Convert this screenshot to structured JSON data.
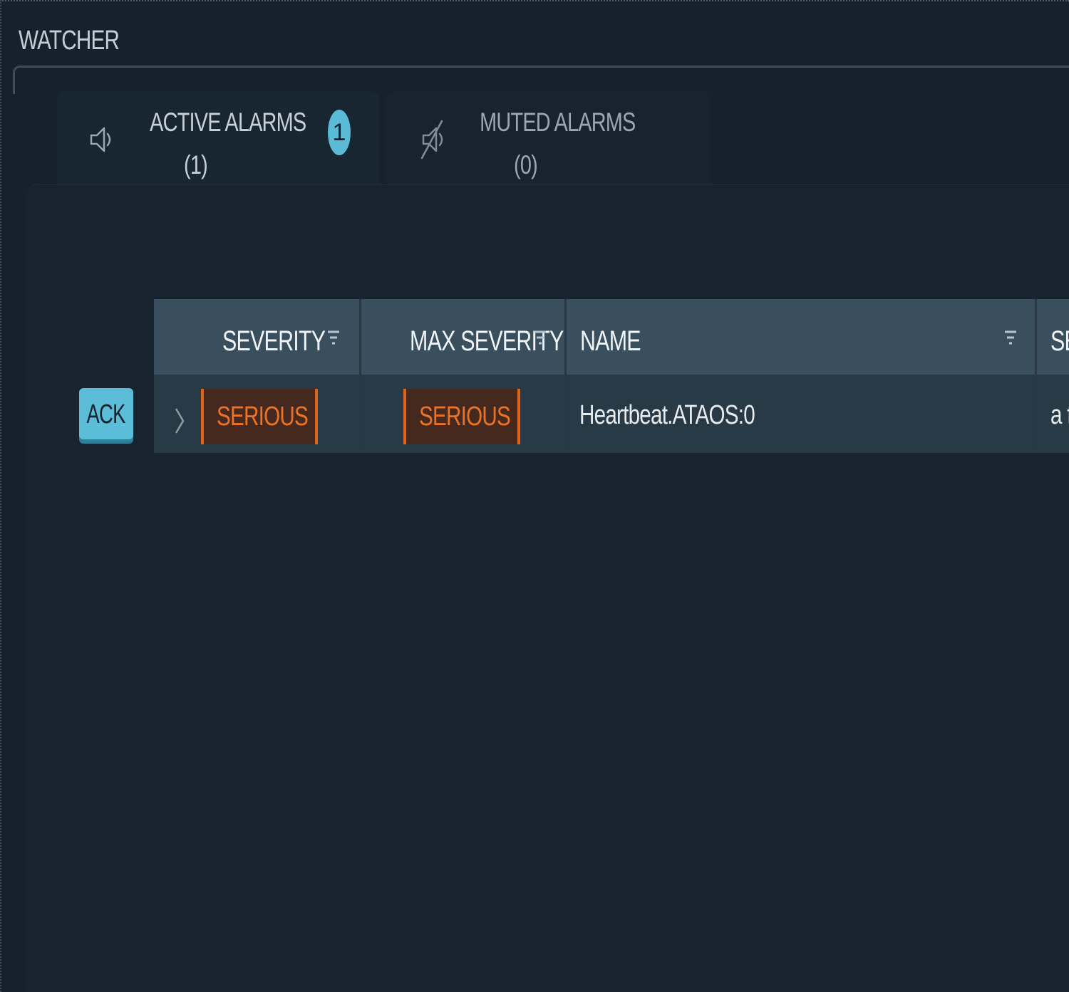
{
  "app": {
    "title": "WATCHER"
  },
  "tabs": [
    {
      "label": "ACTIVE ALARMS",
      "count_text": "(1)",
      "badge": "1",
      "icon": "speaker-icon",
      "active": true
    },
    {
      "label": "MUTED ALARMS",
      "count_text": "(0)",
      "icon": "speaker-muted-icon",
      "active": false
    }
  ],
  "actions": {
    "ack_label": "ACK"
  },
  "table": {
    "columns": [
      {
        "label": "SEVERITY",
        "filter_icon": "filter-icon"
      },
      {
        "label": "MAX SEVERITY",
        "filter_icon": "filter-icon"
      },
      {
        "label": "NAME",
        "filter_icon": "filter-icon"
      },
      {
        "label": "SE"
      }
    ],
    "rows": [
      {
        "severity": "SERIOUS",
        "max_severity": "SERIOUS",
        "name": "Heartbeat.ATAOS:0",
        "fourth": "a fe",
        "expand_icon": "chevron-right-icon"
      }
    ]
  },
  "colors": {
    "accent": "#5cbdd8",
    "serious_text": "#ec7326",
    "serious_border": "#e06418",
    "serious_bg": "#45291f",
    "background": "#15222d",
    "header_bg": "#3a4f5e",
    "row_bg": "#293a47"
  }
}
